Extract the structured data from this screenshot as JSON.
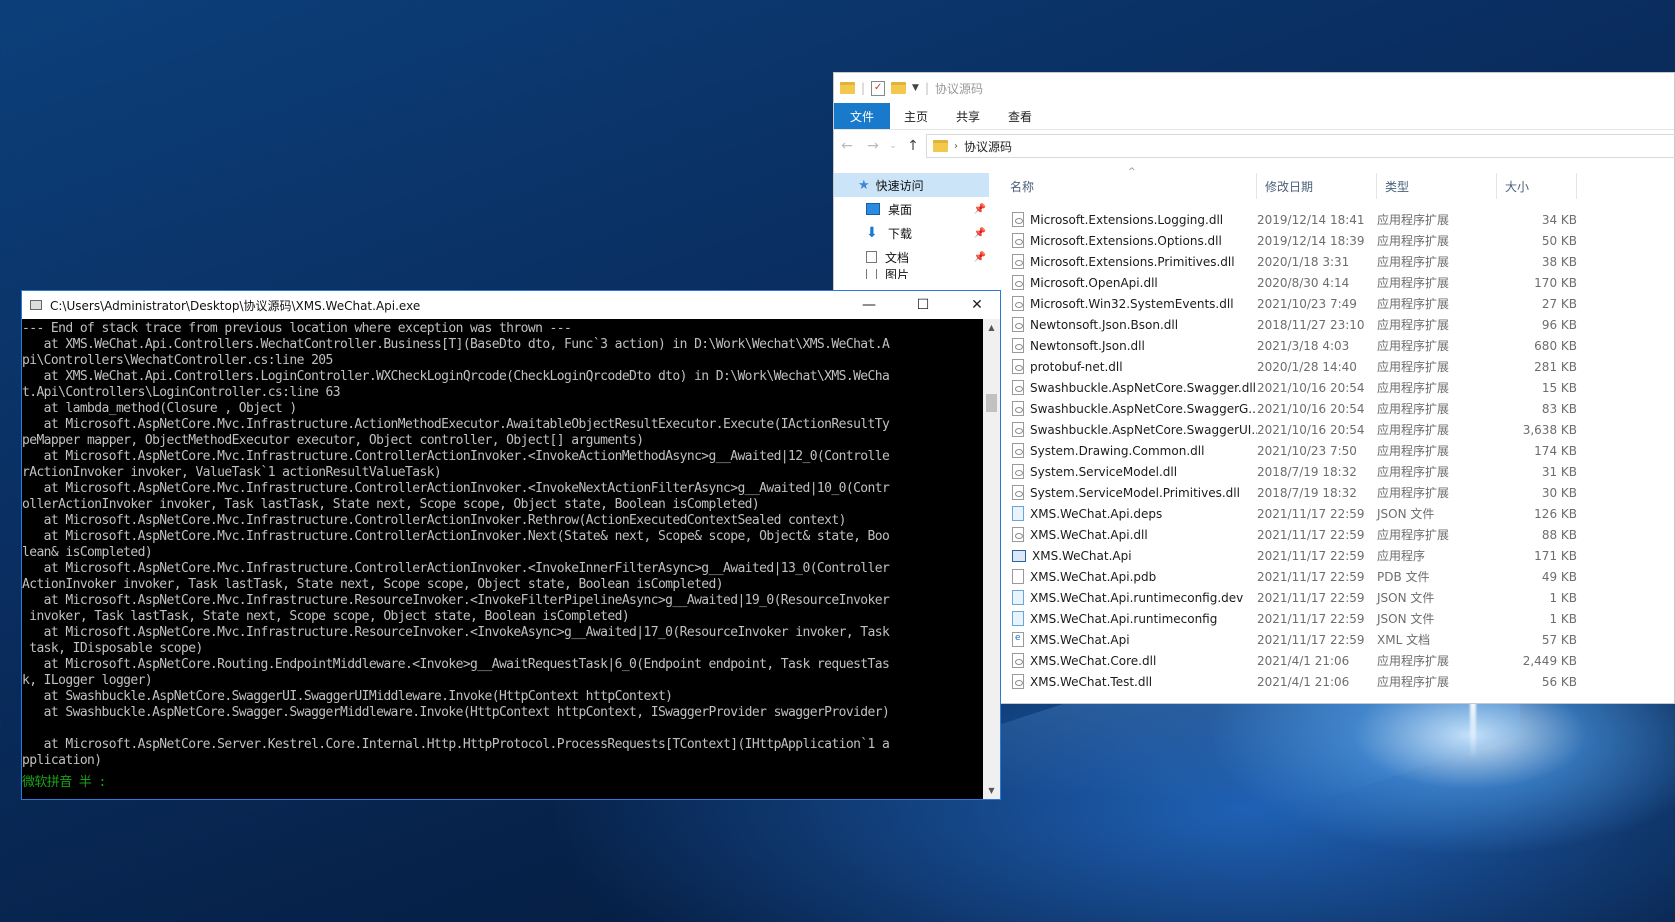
{
  "explorer": {
    "title": "协议源码",
    "ribbon_tabs": [
      "文件",
      "主页",
      "共享",
      "查看"
    ],
    "address_crumb": "协议源码",
    "nav_items": [
      {
        "label": "快速访问",
        "icon": "star-icon"
      },
      {
        "label": "桌面",
        "icon": "desktop-icon",
        "pinned": true
      },
      {
        "label": "下载",
        "icon": "download-icon",
        "pinned": true
      },
      {
        "label": "文档",
        "icon": "document-icon",
        "pinned": true
      },
      {
        "label": "图片",
        "icon": "picture-icon",
        "pinned": true
      }
    ],
    "columns": {
      "name": "名称",
      "date": "修改日期",
      "type": "类型",
      "size": "大小"
    },
    "files": [
      {
        "name": "Microsoft.Extensions.Logging.dll",
        "date": "2019/12/14 18:41",
        "type": "应用程序扩展",
        "size": "34 KB",
        "icon": "dll"
      },
      {
        "name": "Microsoft.Extensions.Options.dll",
        "date": "2019/12/14 18:39",
        "type": "应用程序扩展",
        "size": "50 KB",
        "icon": "dll"
      },
      {
        "name": "Microsoft.Extensions.Primitives.dll",
        "date": "2020/1/18 3:31",
        "type": "应用程序扩展",
        "size": "38 KB",
        "icon": "dll"
      },
      {
        "name": "Microsoft.OpenApi.dll",
        "date": "2020/8/30 4:14",
        "type": "应用程序扩展",
        "size": "170 KB",
        "icon": "dll"
      },
      {
        "name": "Microsoft.Win32.SystemEvents.dll",
        "date": "2021/10/23 7:49",
        "type": "应用程序扩展",
        "size": "27 KB",
        "icon": "dll"
      },
      {
        "name": "Newtonsoft.Json.Bson.dll",
        "date": "2018/11/27 23:10",
        "type": "应用程序扩展",
        "size": "96 KB",
        "icon": "dll"
      },
      {
        "name": "Newtonsoft.Json.dll",
        "date": "2021/3/18 4:03",
        "type": "应用程序扩展",
        "size": "680 KB",
        "icon": "dll"
      },
      {
        "name": "protobuf-net.dll",
        "date": "2020/1/28 14:40",
        "type": "应用程序扩展",
        "size": "281 KB",
        "icon": "dll"
      },
      {
        "name": "Swashbuckle.AspNetCore.Swagger.dll",
        "date": "2021/10/16 20:54",
        "type": "应用程序扩展",
        "size": "15 KB",
        "icon": "dll"
      },
      {
        "name": "Swashbuckle.AspNetCore.SwaggerG...",
        "date": "2021/10/16 20:54",
        "type": "应用程序扩展",
        "size": "83 KB",
        "icon": "dll"
      },
      {
        "name": "Swashbuckle.AspNetCore.SwaggerUI...",
        "date": "2021/10/16 20:54",
        "type": "应用程序扩展",
        "size": "3,638 KB",
        "icon": "dll"
      },
      {
        "name": "System.Drawing.Common.dll",
        "date": "2021/10/23 7:50",
        "type": "应用程序扩展",
        "size": "174 KB",
        "icon": "dll"
      },
      {
        "name": "System.ServiceModel.dll",
        "date": "2018/7/19 18:32",
        "type": "应用程序扩展",
        "size": "31 KB",
        "icon": "dll"
      },
      {
        "name": "System.ServiceModel.Primitives.dll",
        "date": "2018/7/19 18:32",
        "type": "应用程序扩展",
        "size": "30 KB",
        "icon": "dll"
      },
      {
        "name": "XMS.WeChat.Api.deps",
        "date": "2021/11/17 22:59",
        "type": "JSON 文件",
        "size": "126 KB",
        "icon": "json"
      },
      {
        "name": "XMS.WeChat.Api.dll",
        "date": "2021/11/17 22:59",
        "type": "应用程序扩展",
        "size": "88 KB",
        "icon": "dll"
      },
      {
        "name": "XMS.WeChat.Api",
        "date": "2021/11/17 22:59",
        "type": "应用程序",
        "size": "171 KB",
        "icon": "exe"
      },
      {
        "name": "XMS.WeChat.Api.pdb",
        "date": "2021/11/17 22:59",
        "type": "PDB 文件",
        "size": "49 KB",
        "icon": "pdb"
      },
      {
        "name": "XMS.WeChat.Api.runtimeconfig.dev",
        "date": "2021/11/17 22:59",
        "type": "JSON 文件",
        "size": "1 KB",
        "icon": "json"
      },
      {
        "name": "XMS.WeChat.Api.runtimeconfig",
        "date": "2021/11/17 22:59",
        "type": "JSON 文件",
        "size": "1 KB",
        "icon": "json"
      },
      {
        "name": "XMS.WeChat.Api",
        "date": "2021/11/17 22:59",
        "type": "XML 文档",
        "size": "57 KB",
        "icon": "xml"
      },
      {
        "name": "XMS.WeChat.Core.dll",
        "date": "2021/4/1 21:06",
        "type": "应用程序扩展",
        "size": "2,449 KB",
        "icon": "dll"
      },
      {
        "name": "XMS.WeChat.Test.dll",
        "date": "2021/4/1 21:06",
        "type": "应用程序扩展",
        "size": "56 KB",
        "icon": "dll"
      }
    ]
  },
  "console": {
    "title": "C:\\Users\\Administrator\\Desktop\\协议源码\\XMS.WeChat.Api.exe",
    "lines": [
      "--- End of stack trace from previous location where exception was thrown ---",
      "   at XMS.WeChat.Api.Controllers.WechatController.Business[T](BaseDto dto, Func`3 action) in D:\\Work\\Wechat\\XMS.WeChat.A",
      "pi\\Controllers\\WechatController.cs:line 205",
      "   at XMS.WeChat.Api.Controllers.LoginController.WXCheckLoginQrcode(CheckLoginQrcodeDto dto) in D:\\Work\\Wechat\\XMS.WeCha",
      "t.Api\\Controllers\\LoginController.cs:line 63",
      "   at lambda_method(Closure , Object )",
      "   at Microsoft.AspNetCore.Mvc.Infrastructure.ActionMethodExecutor.AwaitableObjectResultExecutor.Execute(IActionResultTy",
      "peMapper mapper, ObjectMethodExecutor executor, Object controller, Object[] arguments)",
      "   at Microsoft.AspNetCore.Mvc.Infrastructure.ControllerActionInvoker.<InvokeActionMethodAsync>g__Awaited|12_0(Controlle",
      "rActionInvoker invoker, ValueTask`1 actionResultValueTask)",
      "   at Microsoft.AspNetCore.Mvc.Infrastructure.ControllerActionInvoker.<InvokeNextActionFilterAsync>g__Awaited|10_0(Contr",
      "ollerActionInvoker invoker, Task lastTask, State next, Scope scope, Object state, Boolean isCompleted)",
      "   at Microsoft.AspNetCore.Mvc.Infrastructure.ControllerActionInvoker.Rethrow(ActionExecutedContextSealed context)",
      "   at Microsoft.AspNetCore.Mvc.Infrastructure.ControllerActionInvoker.Next(State& next, Scope& scope, Object& state, Boo",
      "lean& isCompleted)",
      "   at Microsoft.AspNetCore.Mvc.Infrastructure.ControllerActionInvoker.<InvokeInnerFilterAsync>g__Awaited|13_0(Controller",
      "ActionInvoker invoker, Task lastTask, State next, Scope scope, Object state, Boolean isCompleted)",
      "   at Microsoft.AspNetCore.Mvc.Infrastructure.ResourceInvoker.<InvokeFilterPipelineAsync>g__Awaited|19_0(ResourceInvoker",
      " invoker, Task lastTask, State next, Scope scope, Object state, Boolean isCompleted)",
      "   at Microsoft.AspNetCore.Mvc.Infrastructure.ResourceInvoker.<InvokeAsync>g__Awaited|17_0(ResourceInvoker invoker, Task",
      " task, IDisposable scope)",
      "   at Microsoft.AspNetCore.Routing.EndpointMiddleware.<Invoke>g__AwaitRequestTask|6_0(Endpoint endpoint, Task requestTas",
      "k, ILogger logger)",
      "   at Swashbuckle.AspNetCore.SwaggerUI.SwaggerUIMiddleware.Invoke(HttpContext httpContext)",
      "   at Swashbuckle.AspNetCore.Swagger.SwaggerMiddleware.Invoke(HttpContext httpContext, ISwaggerProvider swaggerProvider)",
      "",
      "   at Microsoft.AspNetCore.Server.Kestrel.Core.Internal.Http.HttpProtocol.ProcessRequests[TContext](IHttpApplication`1 a",
      "pplication)"
    ],
    "ime_status": "微软拼音 半 :",
    "window_buttons": {
      "minimize": "—",
      "maximize": "☐",
      "close": "✕"
    }
  }
}
